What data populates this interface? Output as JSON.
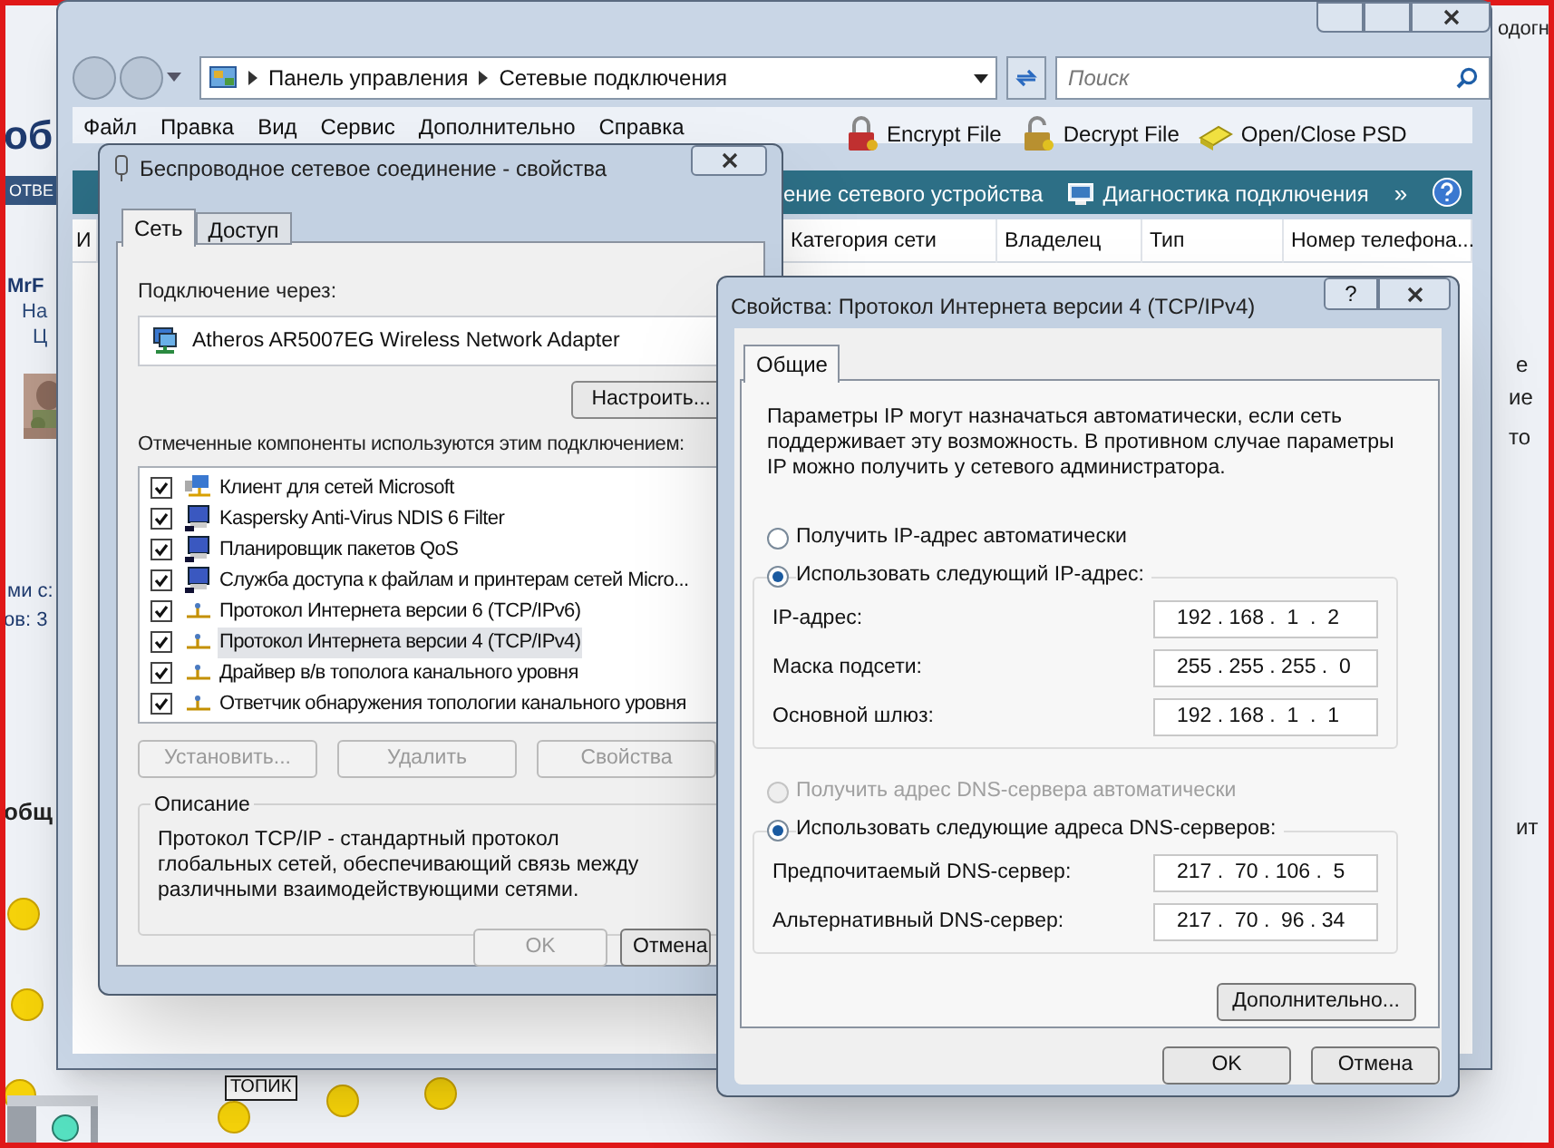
{
  "forum": {
    "heading": "об",
    "top_right": "одогн",
    "reply_bar": "ОТВЕ",
    "user_name": "MrF",
    "user_lines": [
      "На",
      "Ц"
    ],
    "stats": [
      "ми с:",
      "ов: 3"
    ],
    "section": "общ",
    "right_texts": [
      "е",
      "ие",
      "то",
      "ит"
    ],
    "sign_text": "ТОПИК"
  },
  "explorer": {
    "breadcrumb": [
      "Панель управления",
      "Сетевые подключения"
    ],
    "search": {
      "placeholder": "Поиск"
    },
    "menu": [
      "Файл",
      "Правка",
      "Вид",
      "Сервис",
      "Дополнительно",
      "Справка"
    ],
    "tools": [
      {
        "label": "Encrypt File",
        "kind": "lock"
      },
      {
        "label": "Decrypt File",
        "kind": "unlock"
      },
      {
        "label": "Open/Close PSD",
        "kind": "drive"
      }
    ],
    "commands": [
      {
        "label": "ение сетевого устройства",
        "kind": "text"
      },
      {
        "label": "Диагностика подключения",
        "kind": "diagnose"
      }
    ],
    "more": "»",
    "columns": [
      "И",
      "Категория сети",
      "Владелец",
      "Тип",
      "Номер телефона..."
    ]
  },
  "connection_dialog": {
    "title": "Беспроводное сетевое соединение - свойства",
    "tabs": [
      {
        "label": "Сеть",
        "selected": true
      },
      {
        "label": "Доступ",
        "selected": false
      }
    ],
    "connect_using_label": "Подключение через:",
    "adapter": "Atheros AR5007EG Wireless Network Adapter",
    "configure_button": "Настроить...",
    "components_label": "Отмеченные компоненты используются этим подключением:",
    "components": [
      {
        "label": "Клиент для сетей Microsoft",
        "checked": true,
        "selected": false,
        "kind": "client"
      },
      {
        "label": "Kaspersky Anti-Virus NDIS 6 Filter",
        "checked": true,
        "selected": false,
        "kind": "service"
      },
      {
        "label": "Планировщик пакетов QoS",
        "checked": true,
        "selected": false,
        "kind": "service"
      },
      {
        "label": "Служба доступа к файлам и принтерам сетей Micro...",
        "checked": true,
        "selected": false,
        "kind": "service"
      },
      {
        "label": "Протокол Интернета версии 6 (TCP/IPv6)",
        "checked": true,
        "selected": false,
        "kind": "protocol"
      },
      {
        "label": "Протокол Интернета версии 4 (TCP/IPv4)",
        "checked": true,
        "selected": true,
        "kind": "protocol"
      },
      {
        "label": "Драйвер в/в тополога канального уровня",
        "checked": true,
        "selected": false,
        "kind": "protocol"
      },
      {
        "label": "Ответчик обнаружения топологии канального уровня",
        "checked": true,
        "selected": false,
        "kind": "protocol"
      }
    ],
    "buttons": [
      {
        "label": "Установить...",
        "disabled": true
      },
      {
        "label": "Удалить",
        "disabled": true
      },
      {
        "label": "Свойства",
        "disabled": true
      }
    ],
    "description": {
      "legend": "Описание",
      "text": "Протокол TCP/IP - стандартный протокол глобальных сетей, обеспечивающий связь между различными взаимодействующими сетями."
    },
    "footer_buttons": [
      {
        "label": "OK",
        "disabled": true
      },
      {
        "label": "Отмена",
        "disabled": false
      }
    ]
  },
  "ipv4_dialog": {
    "title": "Свойства: Протокол Интернета версии 4 (TCP/IPv4)",
    "help_button": "?",
    "tabs": [
      {
        "label": "Общие",
        "selected": true
      }
    ],
    "intro": "Параметры IP могут назначаться автоматически, если сеть поддерживает эту возможность. В противном случае параметры IP можно получить у сетевого администратора.",
    "ip_mode": [
      {
        "label": "Получить IP-адрес автоматически",
        "selected": false,
        "disabled": false
      },
      {
        "label": "Использовать следующий IP-адрес:",
        "selected": true,
        "disabled": false
      }
    ],
    "ip_fields": [
      {
        "label": "IP-адрес:",
        "value": "192 . 168 .  1  .  2"
      },
      {
        "label": "Маска подсети:",
        "value": "255 . 255 . 255 .  0"
      },
      {
        "label": "Основной шлюз:",
        "value": "192 . 168 .  1  .  1"
      }
    ],
    "dns_mode": [
      {
        "label": "Получить адрес DNS-сервера автоматически",
        "selected": false,
        "disabled": true
      },
      {
        "label": "Использовать следующие адреса DNS-серверов:",
        "selected": true,
        "disabled": false
      }
    ],
    "dns_fields": [
      {
        "label": "Предпочитаемый DNS-сервер:",
        "value": "217 .  70 . 106 .  5"
      },
      {
        "label": "Альтернативный DNS-сервер:",
        "value": "217 .  70 .  96 . 34"
      }
    ],
    "advanced_button": "Дополнительно...",
    "footer_buttons": [
      {
        "label": "OK",
        "disabled": false
      },
      {
        "label": "Отмена",
        "disabled": false
      }
    ]
  }
}
